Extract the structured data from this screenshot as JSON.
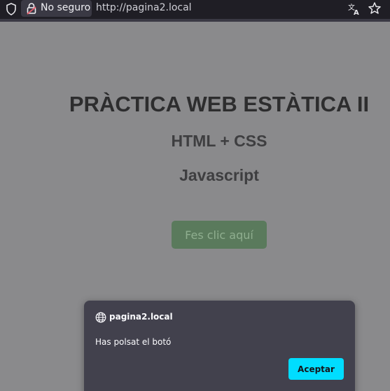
{
  "browser": {
    "security_label": "No seguro",
    "url": "http://pagina2.local",
    "icons": [
      "shield-icon",
      "lock-icon",
      "translate-icon",
      "star-icon"
    ]
  },
  "page": {
    "title": "PRÀCTICA WEB ESTÀTICA II",
    "subtitle_1": "HTML + CSS",
    "subtitle_2": "Javascript",
    "button_label": "Fes clic aquí"
  },
  "dialog": {
    "origin": "pagina2.local",
    "message": "Has polsat el botó",
    "accept_label": "Aceptar",
    "accent_color": "#00ddff"
  }
}
